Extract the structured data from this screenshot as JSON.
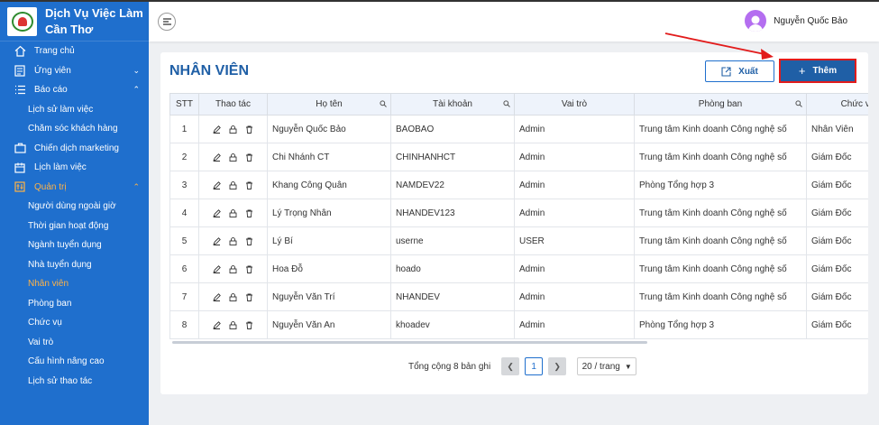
{
  "brand": {
    "name": "Dịch Vụ Việc Làm Cần Thơ"
  },
  "sidebar": {
    "items": [
      {
        "label": "Trang chủ",
        "type": "top",
        "icon": "home-icon"
      },
      {
        "label": "Ứng viên",
        "type": "top",
        "icon": "candidate-icon",
        "chevron": "down"
      },
      {
        "label": "Báo cáo",
        "type": "top",
        "icon": "report-icon",
        "chevron": "up"
      },
      {
        "label": "Lịch sử làm việc",
        "type": "sub"
      },
      {
        "label": "Chăm sóc khách hàng",
        "type": "sub"
      },
      {
        "label": "Chiến dịch marketing",
        "type": "top",
        "icon": "marketing-icon"
      },
      {
        "label": "Lịch làm việc",
        "type": "top",
        "icon": "calendar-icon"
      },
      {
        "label": "Quản trị",
        "type": "top",
        "icon": "admin-icon",
        "chevron": "up",
        "active": true
      },
      {
        "label": "Người dùng ngoài giờ",
        "type": "sub"
      },
      {
        "label": "Thời gian hoạt động",
        "type": "sub"
      },
      {
        "label": "Ngành tuyển dụng",
        "type": "sub"
      },
      {
        "label": "Nhà tuyển dụng",
        "type": "sub"
      },
      {
        "label": "Nhân viên",
        "type": "sub",
        "active": true
      },
      {
        "label": "Phòng ban",
        "type": "sub"
      },
      {
        "label": "Chức vụ",
        "type": "sub"
      },
      {
        "label": "Vai trò",
        "type": "sub"
      },
      {
        "label": "Cấu hình nâng cao",
        "type": "sub"
      },
      {
        "label": "Lịch sử thao tác",
        "type": "sub"
      }
    ]
  },
  "header": {
    "user_name": "Nguyễn Quốc Bảo"
  },
  "main": {
    "title": "NHÂN VIÊN",
    "export_label": "Xuất",
    "add_label": "Thêm",
    "table": {
      "columns": [
        "STT",
        "Thao tác",
        "Họ tên",
        "Tài khoản",
        "Vai trò",
        "Phòng ban",
        "Chức vụ"
      ],
      "rows": [
        {
          "stt": "1",
          "name": "Nguyễn Quốc Bảo",
          "account": "BAOBAO",
          "role": "Admin",
          "dept": "Trung tâm Kinh doanh Công nghệ số",
          "position": "Nhân Viên"
        },
        {
          "stt": "2",
          "name": "Chi Nhánh CT",
          "account": "CHINHANHCT",
          "role": "Admin",
          "dept": "Trung tâm Kinh doanh Công nghệ số",
          "position": "Giám Đốc"
        },
        {
          "stt": "3",
          "name": "Khang Công Quân",
          "account": "NAMDEV22",
          "role": "Admin",
          "dept": "Phòng Tổng hợp 3",
          "position": "Giám Đốc"
        },
        {
          "stt": "4",
          "name": "Lý Trọng Nhân",
          "account": "NHANDEV123",
          "role": "Admin",
          "dept": "Trung tâm Kinh doanh Công nghệ số",
          "position": "Giám Đốc"
        },
        {
          "stt": "5",
          "name": "Lý Bí",
          "account": "userne",
          "role": "USER",
          "dept": "Trung tâm Kinh doanh Công nghệ số",
          "position": "Giám Đốc"
        },
        {
          "stt": "6",
          "name": "Hoa Đỗ",
          "account": "hoado",
          "role": "Admin",
          "dept": "Trung tâm Kinh doanh Công nghệ số",
          "position": "Giám Đốc"
        },
        {
          "stt": "7",
          "name": "Nguyễn Văn Trí",
          "account": "NHANDEV",
          "role": "Admin",
          "dept": "Trung tâm Kinh doanh Công nghệ số",
          "position": "Giám Đốc"
        },
        {
          "stt": "8",
          "name": "Nguyễn Văn An",
          "account": "khoadev",
          "role": "Admin",
          "dept": "Phòng Tổng hợp 3",
          "position": "Giám Đốc"
        }
      ]
    },
    "pagination": {
      "total_text": "Tổng cộng 8 bản ghi",
      "current_page": "1",
      "page_size": "20 / trang"
    }
  },
  "colors": {
    "sidebar": "#1f6fcd",
    "accent": "#1f5fa6",
    "active": "#ffb347",
    "highlight": "#e21b1b"
  }
}
